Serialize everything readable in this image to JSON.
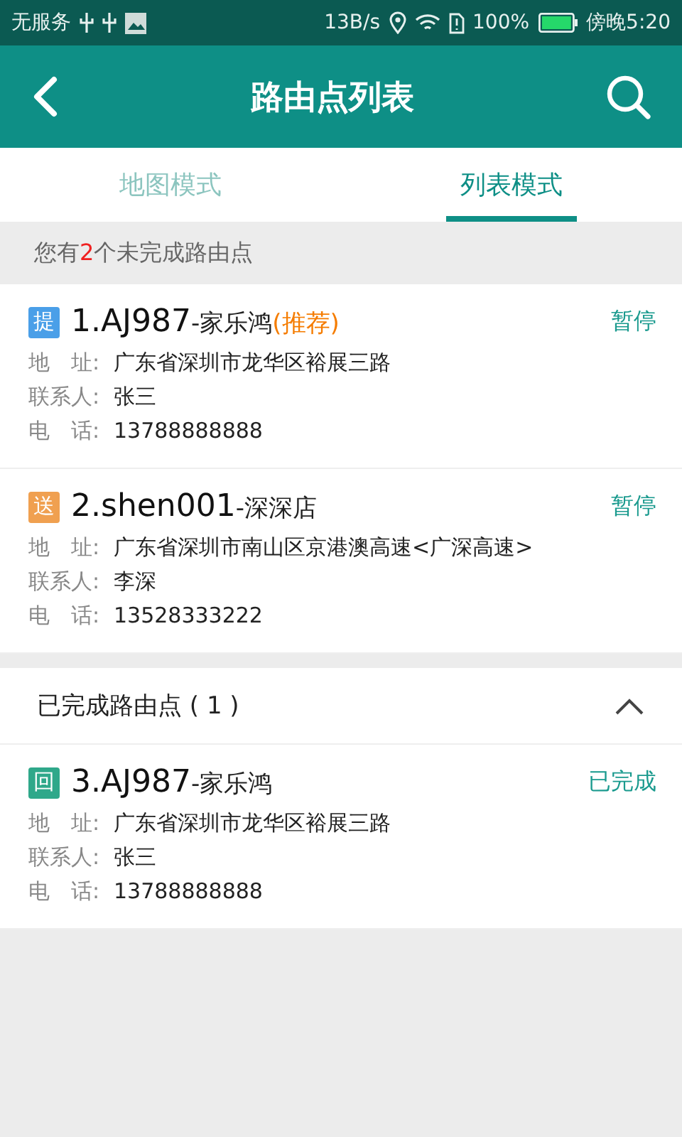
{
  "status_bar": {
    "carrier": "无服务",
    "speed": "13B/s",
    "battery": "100%",
    "time": "傍晚5:20"
  },
  "header": {
    "title": "路由点列表"
  },
  "tabs": [
    {
      "label": "地图模式",
      "selected": false
    },
    {
      "label": "列表模式",
      "selected": true
    }
  ],
  "summary": {
    "prefix": "您有",
    "count": "2",
    "suffix": "个未完成路由点"
  },
  "pending": [
    {
      "badge": "提",
      "color": "#4a9fe8",
      "code": "1.AJ987",
      "name": "-家乐鸿",
      "tag": "(推荐)",
      "status": "暂停",
      "fields": [
        {
          "label": "地　址:",
          "value": "广东省深圳市龙华区裕展三路"
        },
        {
          "label": "联系人:",
          "value": "张三"
        },
        {
          "label": "电　话:",
          "value": "13788888888"
        }
      ]
    },
    {
      "badge": "送",
      "color": "#f0a050",
      "code": "2.shen001",
      "name": "-深深店",
      "status": "暂停",
      "fields": [
        {
          "label": "地　址:",
          "value": "广东省深圳市南山区京港澳高速<广深高速>"
        },
        {
          "label": "联系人:",
          "value": "李深"
        },
        {
          "label": "电　话:",
          "value": "13528333222"
        }
      ]
    }
  ],
  "completed_section": {
    "title": "已完成路由点 ( 1 )",
    "expanded": true
  },
  "completed": [
    {
      "badge": "回",
      "color": "#2fa88a",
      "code": "3.AJ987",
      "name": "-家乐鸿",
      "status": "已完成",
      "fields": [
        {
          "label": "地　址:",
          "value": "广东省深圳市龙华区裕展三路"
        },
        {
          "label": "联系人:",
          "value": "张三"
        },
        {
          "label": "电　话:",
          "value": "13788888888"
        }
      ]
    }
  ]
}
